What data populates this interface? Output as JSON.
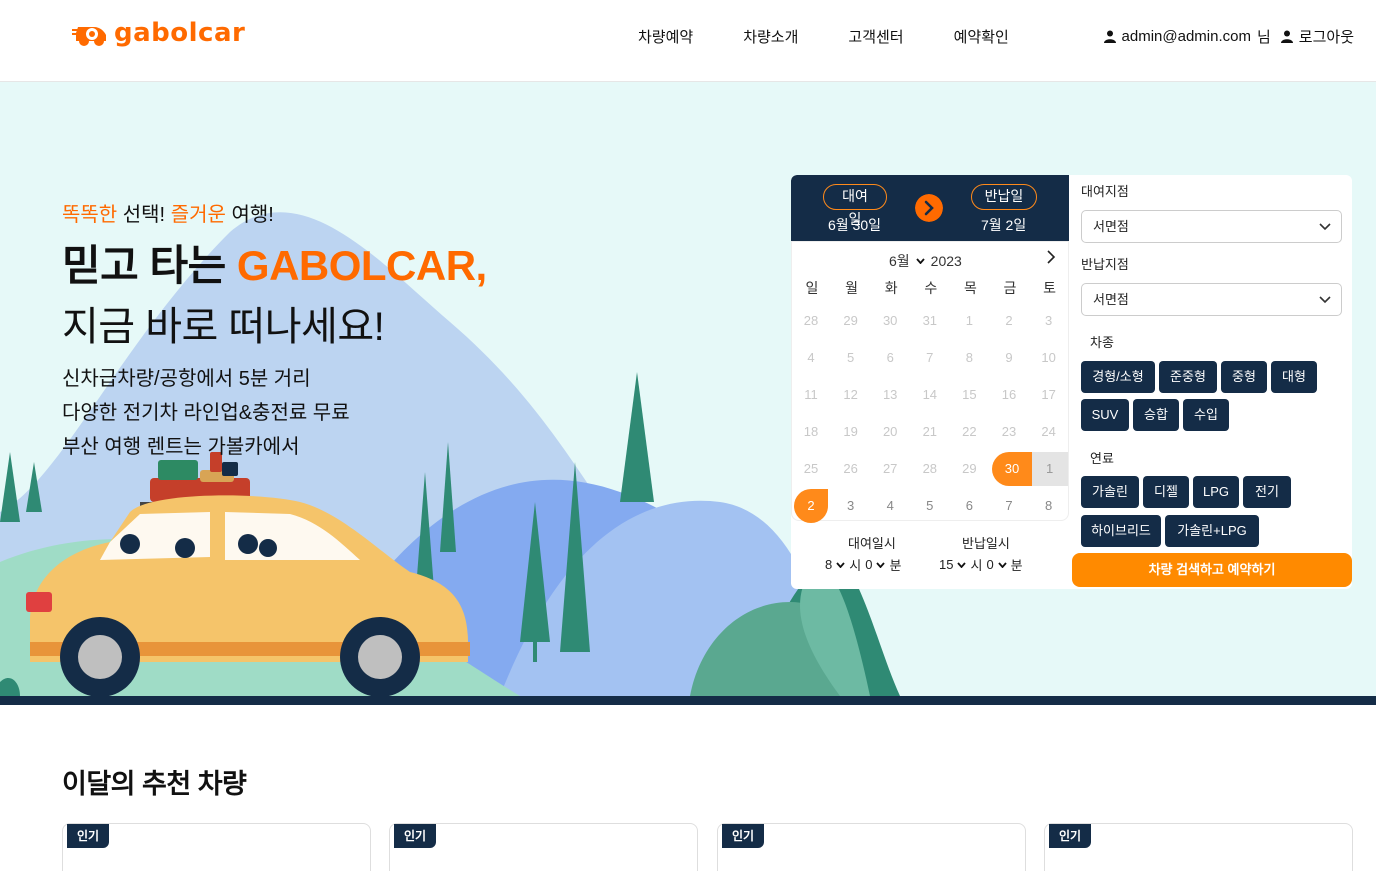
{
  "header": {
    "logo_text": "gabolcar",
    "nav": [
      "차량예약",
      "차량소개",
      "고객센터",
      "예약확인"
    ],
    "user_email": "admin@admin.com",
    "user_suffix": "님",
    "logout": "로그아웃"
  },
  "hero": {
    "tagline_a": "똑똑한",
    "tagline_b": " 선택! ",
    "tagline_c": "즐거운",
    "tagline_d": " 여행!",
    "headline1_a": "믿고 타는 ",
    "headline1_b": "GABOLCAR,",
    "headline2": "지금 바로 떠나세요!",
    "desc": [
      "신차급차량/공항에서 5분 거리",
      "다양한 전기차 라인업&충전료 무료",
      "부산 여행 렌트는 가볼카에서"
    ]
  },
  "booking": {
    "rent_label": "대여일",
    "rent_date": "6월 30일",
    "return_label": "반납일",
    "return_date": "7월 2일",
    "calendar": {
      "month": "6월",
      "year": "2023",
      "weekdays": [
        "일",
        "월",
        "화",
        "수",
        "목",
        "금",
        "토"
      ],
      "rows": [
        [
          "28",
          "29",
          "30",
          "31",
          "1",
          "2",
          "3"
        ],
        [
          "4",
          "5",
          "6",
          "7",
          "8",
          "9",
          "10"
        ],
        [
          "11",
          "12",
          "13",
          "14",
          "15",
          "16",
          "17"
        ],
        [
          "18",
          "19",
          "20",
          "21",
          "22",
          "23",
          "24"
        ],
        [
          "25",
          "26",
          "27",
          "28",
          "29",
          "30",
          "1"
        ],
        [
          "2",
          "3",
          "4",
          "5",
          "6",
          "7",
          "8"
        ]
      ]
    },
    "rent_time_label": "대여일시",
    "return_time_label": "반납일시",
    "rent_hour": "8",
    "rent_min": "0",
    "return_hour": "15",
    "return_min": "0",
    "hour_unit": "시",
    "min_unit": "분",
    "pickup_label": "대여지점",
    "pickup_value": "서면점",
    "return_branch_label": "반납지점",
    "return_branch_value": "서면점",
    "car_type_label": "차종",
    "car_types": [
      "경형/소형",
      "준중형",
      "중형",
      "대형",
      "SUV",
      "승합",
      "수입"
    ],
    "fuel_label": "연료",
    "fuels": [
      "가솔린",
      "디젤",
      "LPG",
      "전기",
      "하이브리드",
      "가솔린+LPG"
    ],
    "search_button": "차량 검색하고 예약하기"
  },
  "recommend": {
    "title": "이달의 추천 차량",
    "badges": [
      "인기",
      "인기",
      "인기",
      "인기"
    ]
  },
  "colors": {
    "brand_orange": "#ff6a00",
    "navy": "#142c47",
    "hero_bg": "#e6f9f8"
  }
}
